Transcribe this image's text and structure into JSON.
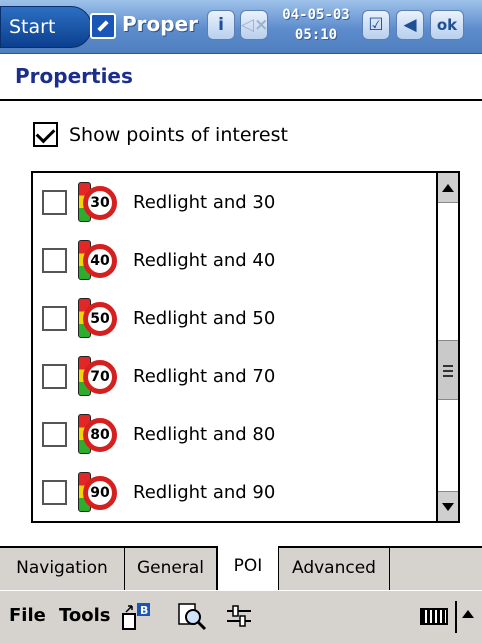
{
  "titlebar": {
    "start_label": "Start",
    "app_title": "Proper",
    "date": "04-05-03",
    "time": "05:10",
    "ok_label": "ok",
    "icons": [
      "app-icon",
      "info-icon",
      "volume-muted-icon",
      "task-check-icon",
      "back-icon"
    ]
  },
  "page": {
    "title": "Properties",
    "title_color": "#1b2e8c"
  },
  "poi_toggle": {
    "label": "Show points of interest",
    "checked": true
  },
  "list": {
    "items": [
      {
        "label": "Redlight and 30",
        "speed": "30",
        "checked": false
      },
      {
        "label": "Redlight and 40",
        "speed": "40",
        "checked": false
      },
      {
        "label": "Redlight and 50",
        "speed": "50",
        "checked": false
      },
      {
        "label": "Redlight and 70",
        "speed": "70",
        "checked": false
      },
      {
        "label": "Redlight and 80",
        "speed": "80",
        "checked": false
      },
      {
        "label": "Redlight and 90",
        "speed": "90",
        "checked": false
      }
    ],
    "scroll_position": 0.6
  },
  "tabs": [
    {
      "label": "Navigation",
      "active": false
    },
    {
      "label": "General",
      "active": false
    },
    {
      "label": "POI",
      "active": true
    },
    {
      "label": "Advanced",
      "active": false
    }
  ],
  "menubar": {
    "file_label": "File",
    "tools_label": "Tools",
    "icons": [
      "bluetooth-transfer-icon",
      "search-icon",
      "settings-sliders-icon",
      "keyboard-icon",
      "input-arrow-icon"
    ]
  }
}
